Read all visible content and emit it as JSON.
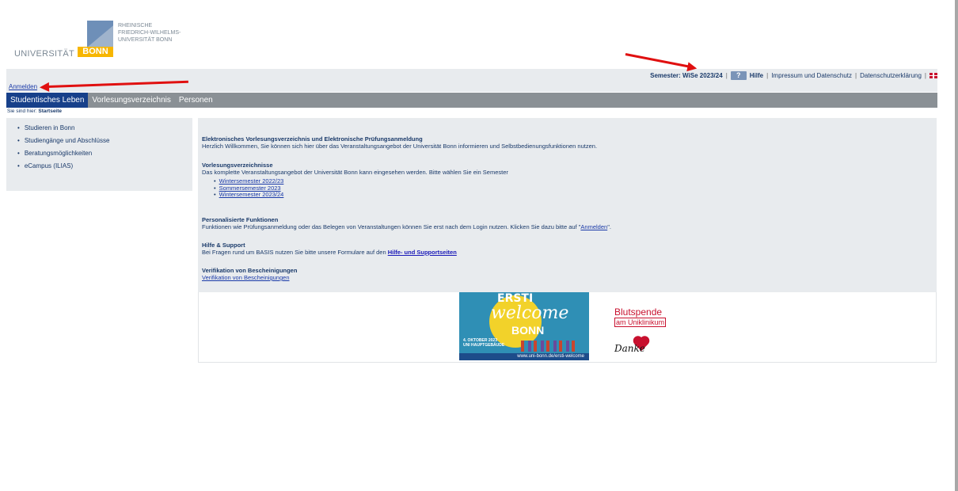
{
  "logo": {
    "university_word": "UNIVERSITÄT",
    "bonn_word": "BONN",
    "subtitle_lines": [
      "RHEINISCHE",
      "FRIEDRICH-WILHELMS-",
      "UNIVERSITÄT BONN"
    ]
  },
  "topbar": {
    "login_link": "Anmelden",
    "semester_text": "Semester: WiSe 2023/24",
    "help_icon_label": "?",
    "help_link": "Hilfe",
    "impressum_link": "Impressum und Datenschutz",
    "privacy_link": "Datenschutzerklärung",
    "separator": "|"
  },
  "nav": {
    "tabs": [
      "Studentisches Leben",
      "Vorlesungsverzeichnis",
      "Personen"
    ],
    "active_tab": "Studentisches Leben"
  },
  "breadcrumb": {
    "prefix": "Sie sind hier:",
    "current": "Startseite"
  },
  "sidebar": {
    "items": [
      "Studieren in Bonn",
      "Studiengänge und Abschlüsse",
      "Beratungsmöglichkeiten",
      "eCampus (ILIAS)"
    ]
  },
  "content": {
    "intro": {
      "heading": "Elektronisches Vorlesungsverzeichnis und Elektronische Prüfungsanmeldung",
      "text": "Herzlich Willkommen, Sie können sich hier über das Veranstaltungsangebot der Universität Bonn informieren und Selbstbedienungsfunktionen nutzen."
    },
    "vv": {
      "heading": "Vorlesungsverzeichnisse",
      "text": "Das komplette Veranstaltungsangebot der Universität Bonn kann eingesehen werden. Bitte wählen Sie ein Semester",
      "semesters": [
        "Wintersemester 2022/23",
        "Sommersemester 2023",
        "Wintersemester 2023/24"
      ]
    },
    "personal": {
      "heading": "Personalisierte Funktionen",
      "text_before": "Funktionen wie Prüfungsanmeldung oder das Belegen von Veranstaltungen können Sie erst nach dem Login nutzen. Klicken Sie dazu bitte auf \"",
      "link": "Anmelden",
      "text_after": "\"."
    },
    "help": {
      "heading": "Hilfe & Support",
      "text": "Bei Fragen rund um BASIS nutzen Sie bitte unsere Formulare auf den ",
      "link": "Hilfe- und Supportseiten"
    },
    "verify": {
      "heading": "Verifikation von Bescheinigungen",
      "link": "Verifikation von Bescheinigungen"
    }
  },
  "banners": {
    "ersti": {
      "line1": "ERSTI",
      "line2": "welcome",
      "line3": "BONN",
      "date": "4. OKTOBER 2023",
      "place": "UNI HAUPTGEBÄUDE",
      "url": "www.uni-bonn.de/ersti-welcome"
    },
    "blood": {
      "line1": "Blutspende",
      "line2": "am Uniklinikum",
      "thanks": "Danke"
    }
  },
  "colors": {
    "nav_active": "#17408a",
    "nav_bar": "#8a9095",
    "panel": "#e8ebee",
    "accent_yellow": "#f7b600",
    "annotation": "#e01010"
  }
}
